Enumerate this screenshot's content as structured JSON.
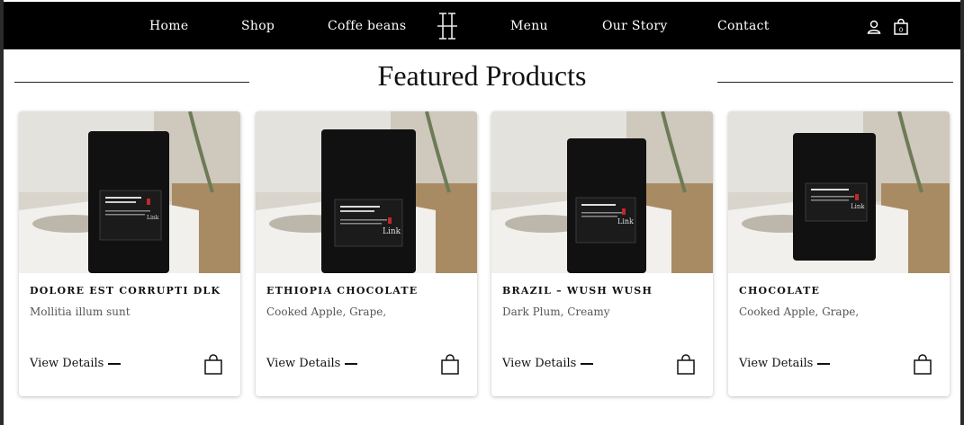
{
  "nav": {
    "items": [
      "Home",
      "Shop",
      "Coffe beans",
      "Menu",
      "Our Story",
      "Contact"
    ],
    "logo_icon": "brand-monogram-icon",
    "account_icon": "user-icon",
    "cart_icon": "shopping-bag-icon",
    "cart_count": "0"
  },
  "section": {
    "title": "Featured Products"
  },
  "products": [
    {
      "title": "DOLORE EST CORRUPTI DLK",
      "desc": "Mollitia illum sunt",
      "link": "View Details",
      "bag_label": "Link"
    },
    {
      "title": "ETHIOPIA CHOCOLATE",
      "desc": "Cooked Apple, Grape,",
      "link": "View Details",
      "bag_label": "Link"
    },
    {
      "title": "BRAZIL – WUSH WUSH",
      "desc": "Dark Plum, Creamy",
      "link": "View Details",
      "bag_label": "Link"
    },
    {
      "title": "CHOCOLATE",
      "desc": "Cooked Apple, Grape,",
      "link": "View Details",
      "bag_label": "Link"
    }
  ],
  "colors": {
    "nav_bg": "#000000",
    "nav_text": "#ffffff",
    "page_bg": "#ffffff",
    "text": "#111111"
  }
}
